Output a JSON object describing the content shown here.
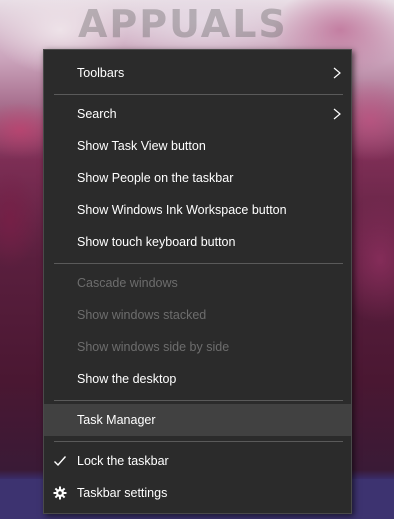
{
  "watermark": {
    "text": "APPUALS"
  },
  "menu": {
    "toolbars": "Toolbars",
    "search": "Search",
    "show_task_view": "Show Task View button",
    "show_people": "Show People on the taskbar",
    "show_ink_workspace": "Show Windows Ink Workspace button",
    "show_touch_keyboard": "Show touch keyboard button",
    "cascade_windows": "Cascade windows",
    "show_windows_stacked": "Show windows stacked",
    "show_windows_side_by_side": "Show windows side by side",
    "show_desktop": "Show the desktop",
    "task_manager": "Task Manager",
    "lock_taskbar": "Lock the taskbar",
    "taskbar_settings": "Taskbar settings"
  },
  "icons": {
    "submenu": "chevron-right-icon",
    "lock_check": "checkmark-icon",
    "settings": "gear-icon"
  },
  "colors": {
    "menu_bg": "#2b2b2b",
    "text": "#ffffff",
    "disabled_text": "#6d6d6d",
    "hover_bg": "#414141",
    "separator": "#5a5a5a"
  }
}
